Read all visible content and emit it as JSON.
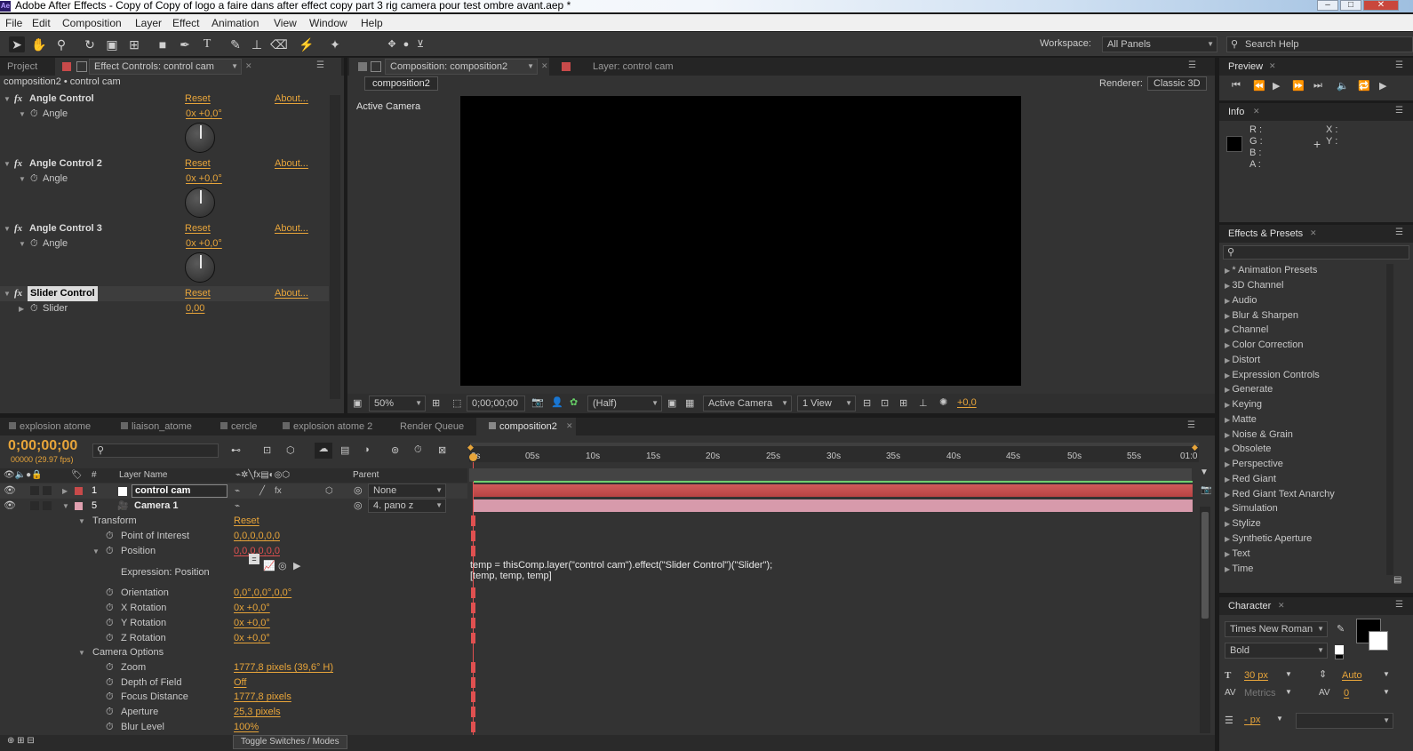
{
  "window": {
    "title": "Adobe After Effects - Copy of Copy of logo a faire dans after effect copy part 3 rig camera pour test ombre avant.aep *",
    "app_icon_text": "Ae"
  },
  "menu": [
    "File",
    "Edit",
    "Composition",
    "Layer",
    "Effect",
    "Animation",
    "View",
    "Window",
    "Help"
  ],
  "toolbar": {
    "workspace_label": "Workspace:",
    "workspace_value": "All Panels",
    "search_placeholder": "Search Help"
  },
  "effect_controls": {
    "tab_project": "Project",
    "tab_label": "Effect Controls: control cam",
    "breadcrumb": "composition2 • control cam",
    "effects": [
      {
        "name": "Angle Control",
        "reset": "Reset",
        "about": "About...",
        "param": "Angle",
        "value": "0x +0,0°"
      },
      {
        "name": "Angle Control 2",
        "reset": "Reset",
        "about": "About...",
        "param": "Angle",
        "value": "0x +0,0°"
      },
      {
        "name": "Angle Control 3",
        "reset": "Reset",
        "about": "About...",
        "param": "Angle",
        "value": "0x +0,0°"
      },
      {
        "name": "Slider Control",
        "reset": "Reset",
        "about": "About...",
        "param": "Slider",
        "value": "0,00"
      }
    ]
  },
  "composition": {
    "tab_label": "Composition: composition2",
    "layer_tab": "Layer: control cam",
    "subtab": "composition2",
    "renderer_label": "Renderer:",
    "renderer_value": "Classic 3D",
    "view_label": "Active Camera",
    "zoom": "50%",
    "timecode": "0;00;00;00",
    "resolution": "(Half)",
    "camera": "Active Camera",
    "views": "1 View",
    "exposure": "+0,0"
  },
  "preview": {
    "tab": "Preview"
  },
  "info": {
    "tab": "Info",
    "labels": [
      "R :",
      "G :",
      "B :",
      "A :"
    ],
    "coords": [
      "X :",
      "Y :"
    ]
  },
  "effects_presets": {
    "tab": "Effects & Presets",
    "items": [
      "* Animation Presets",
      "3D Channel",
      "Audio",
      "Blur & Sharpen",
      "Channel",
      "Color Correction",
      "Distort",
      "Expression Controls",
      "Generate",
      "Keying",
      "Matte",
      "Noise & Grain",
      "Obsolete",
      "Perspective",
      "Red Giant",
      "Red Giant Text Anarchy",
      "Simulation",
      "Stylize",
      "Synthetic Aperture",
      "Text",
      "Time"
    ]
  },
  "character": {
    "tab": "Character",
    "font": "Times New Roman",
    "style": "Bold",
    "size": "30 px",
    "leading": "Auto",
    "kerning": "Metrics",
    "tracking": "0",
    "stroke": "- px"
  },
  "timeline": {
    "tabs": [
      "explosion atome",
      "liaison_atome",
      "cercle",
      "explosion atome 2",
      "Render Queue",
      "composition2"
    ],
    "timecode": "0;00;00;00",
    "frames": "00000 (29.97 fps)",
    "col_layer_name": "Layer Name",
    "col_num": "#",
    "col_parent": "Parent",
    "ruler": [
      "0s",
      "05s",
      "10s",
      "15s",
      "20s",
      "25s",
      "30s",
      "35s",
      "40s",
      "45s",
      "50s",
      "55s",
      "01:0"
    ],
    "layers": [
      {
        "num": "1",
        "name": "control cam",
        "parent": "None",
        "color": "#c84a4a"
      },
      {
        "num": "5",
        "name": "Camera 1",
        "parent": "4. pano z",
        "color": "#e0a0b0"
      }
    ],
    "props": {
      "transform": "Transform",
      "transform_reset": "Reset",
      "poi": "Point of Interest",
      "poi_v": "0,0,0,0,0,0",
      "position": "Position",
      "position_v": "0,0,0,0,0,0",
      "expr_label": "Expression: Position",
      "orientation": "Orientation",
      "orientation_v": "0,0°,0,0°,0,0°",
      "xrot": "X Rotation",
      "xrot_v": "0x +0,0°",
      "yrot": "Y Rotation",
      "yrot_v": "0x +0,0°",
      "zrot": "Z Rotation",
      "zrot_v": "0x +0,0°",
      "cam_opts": "Camera Options",
      "zoom": "Zoom",
      "zoom_v": "1777,8 pixels (39,6° H)",
      "dof": "Depth of Field",
      "dof_v": "Off",
      "focus": "Focus Distance",
      "focus_v": "1777,8 pixels",
      "aperture": "Aperture",
      "aperture_v": "25,3 pixels",
      "blur": "Blur Level",
      "blur_v": "100%"
    },
    "expression_line1": "temp = thisComp.layer(\"control cam\").effect(\"Slider Control\")(\"Slider\");",
    "expression_line2": "[temp, temp, temp]",
    "bottom_toggle": "Toggle Switches / Modes"
  }
}
